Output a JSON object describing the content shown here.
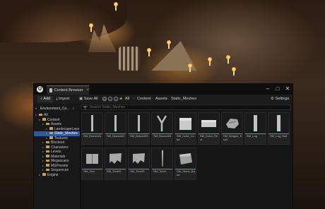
{
  "window": {
    "tab_label": "Content Browser",
    "tab_close": "×",
    "controls": [
      "–",
      "□",
      "✕"
    ]
  },
  "toolbar": {
    "add_label": "Add",
    "import_label": "Import",
    "save_all_label": "Save All",
    "breadcrumbs": [
      "All",
      "Content",
      "Assets",
      "Static_Meshes"
    ],
    "settings_label": "Settings"
  },
  "sources": {
    "header": "Environment_Co...",
    "tree": [
      {
        "label": "All",
        "indent": 0,
        "selected": false
      },
      {
        "label": "Content",
        "indent": 1,
        "selected": false
      },
      {
        "label": "Assets",
        "indent": 2,
        "selected": false
      },
      {
        "label": "LandscapeLaye",
        "indent": 3,
        "selected": false
      },
      {
        "label": "Static_Meshes",
        "indent": 3,
        "selected": true
      },
      {
        "label": "Textures",
        "indent": 3,
        "selected": false
      },
      {
        "label": "Blockout",
        "indent": 2,
        "selected": false
      },
      {
        "label": "Characters",
        "indent": 2,
        "selected": false
      },
      {
        "label": "Levels",
        "indent": 2,
        "selected": false
      },
      {
        "label": "Materials",
        "indent": 2,
        "selected": false
      },
      {
        "label": "Megascans",
        "indent": 2,
        "selected": false
      },
      {
        "label": "MSPresets",
        "indent": 2,
        "selected": false
      },
      {
        "label": "Sequences",
        "indent": 2,
        "selected": false
      },
      {
        "label": "Engine",
        "indent": 1,
        "selected": false
      }
    ]
  },
  "search": {
    "placeholder": "Search Static_Meshes"
  },
  "assets": [
    {
      "name": "SM_Branch01",
      "icon": "stick"
    },
    {
      "name": "SM_Branch02",
      "icon": "stick"
    },
    {
      "name": "SM_Branch03",
      "icon": "stick"
    },
    {
      "name": "SM_Branch04",
      "icon": "fork"
    },
    {
      "name": "SM_Cube_Cube",
      "icon": "cube"
    },
    {
      "name": "SM_Cube_Rect",
      "icon": "slab"
    },
    {
      "name": "SM_Dragon_Skull",
      "icon": "skull"
    },
    {
      "name": "SM_Log",
      "icon": "log"
    },
    {
      "name": "SM_Log_Half",
      "icon": "log"
    },
    {
      "name": "SM_Tom",
      "icon": "book"
    },
    {
      "name": "SM_Torn02",
      "icon": "cloth"
    },
    {
      "name": "SM_Torn03",
      "icon": "cloth"
    },
    {
      "name": "SM_Torch",
      "icon": "spike"
    },
    {
      "name": "SM_Stone_Base",
      "icon": "stone"
    }
  ],
  "colors": {
    "accent": "#2b6fd6",
    "selection": "#2f5a9a",
    "asset_type_bar": "#2fa6c8",
    "folder": "#c8a050"
  }
}
